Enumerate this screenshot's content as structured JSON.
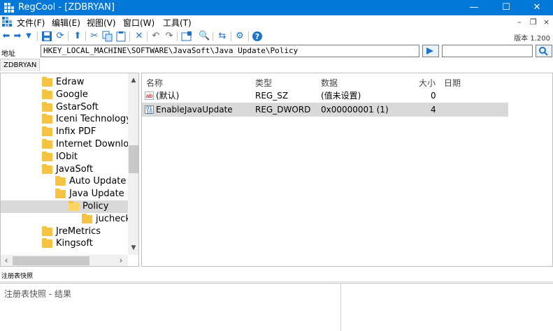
{
  "window": {
    "title": "RegCool - [ZDBRYAN]",
    "controls": {
      "minimize": "—",
      "maximize": "☐",
      "close": "✕"
    }
  },
  "menu": {
    "items": [
      {
        "label": "文件(F)"
      },
      {
        "label": "编辑(E)"
      },
      {
        "label": "视图(V)"
      },
      {
        "label": "窗口(W)"
      },
      {
        "label": "工具(T)"
      }
    ],
    "mdi_controls": {
      "minimize": "–",
      "restore": "❐",
      "close": "×"
    }
  },
  "toolbar": {
    "version": "版本 1.200",
    "icons": [
      "back-icon",
      "forward-icon",
      "dropdown-icon",
      "save-icon",
      "refresh-icon",
      "up-icon",
      "cut-icon",
      "copy-icon",
      "paste-icon",
      "delete-icon",
      "undo-icon",
      "redo-icon",
      "new-key-icon",
      "search-icon",
      "compare-icon",
      "settings-icon",
      "help-icon"
    ]
  },
  "address": {
    "label": "地址",
    "path": "HKEY_LOCAL_MACHINE\\SOFTWARE\\JavaSoft\\Java Update\\Policy",
    "search_value": ""
  },
  "computer_tab": {
    "label": "ZDBRYAN"
  },
  "tree": {
    "items": [
      {
        "label": "Edraw",
        "level": 0,
        "selected": false,
        "open": false
      },
      {
        "label": "Google",
        "level": 0,
        "selected": false,
        "open": false
      },
      {
        "label": "GstarSoft",
        "level": 0,
        "selected": false,
        "open": false
      },
      {
        "label": "Iceni Technology",
        "level": 0,
        "selected": false,
        "open": false
      },
      {
        "label": "Infix PDF",
        "level": 0,
        "selected": false,
        "open": false
      },
      {
        "label": "Internet Downloa",
        "level": 0,
        "selected": false,
        "open": false
      },
      {
        "label": "IObit",
        "level": 0,
        "selected": false,
        "open": false
      },
      {
        "label": "JavaSoft",
        "level": 0,
        "selected": false,
        "open": false
      },
      {
        "label": "Auto Update",
        "level": 1,
        "selected": false,
        "open": false
      },
      {
        "label": "Java Update",
        "level": 1,
        "selected": false,
        "open": false
      },
      {
        "label": "Policy",
        "level": 2,
        "selected": true,
        "open": true
      },
      {
        "label": "jucheck",
        "level": 3,
        "selected": false,
        "open": false
      },
      {
        "label": "JreMetrics",
        "level": 0,
        "selected": false,
        "open": false
      },
      {
        "label": "Kingsoft",
        "level": 0,
        "selected": false,
        "open": false
      }
    ]
  },
  "values": {
    "columns": {
      "name": "名称",
      "type": "类型",
      "data": "数据",
      "size": "大小",
      "date": "日期"
    },
    "rows": [
      {
        "icon": "string-value-icon",
        "name": "(默认)",
        "type": "REG_SZ",
        "data": "(值未设置)",
        "size": "0",
        "date": "",
        "selected": false
      },
      {
        "icon": "dword-value-icon",
        "name": "EnableJavaUpdate",
        "type": "REG_DWORD",
        "data": "0x00000001 (1)",
        "size": "4",
        "date": "",
        "selected": true
      }
    ]
  },
  "snapshot": {
    "header": "注册表快照",
    "body_text": "注册表快照 - 结果"
  },
  "colors": {
    "titlebar": "#0078d7",
    "selection": "#d9d9d9",
    "folder": "#f5c242",
    "toolbar_blue": "#1e73c8"
  }
}
